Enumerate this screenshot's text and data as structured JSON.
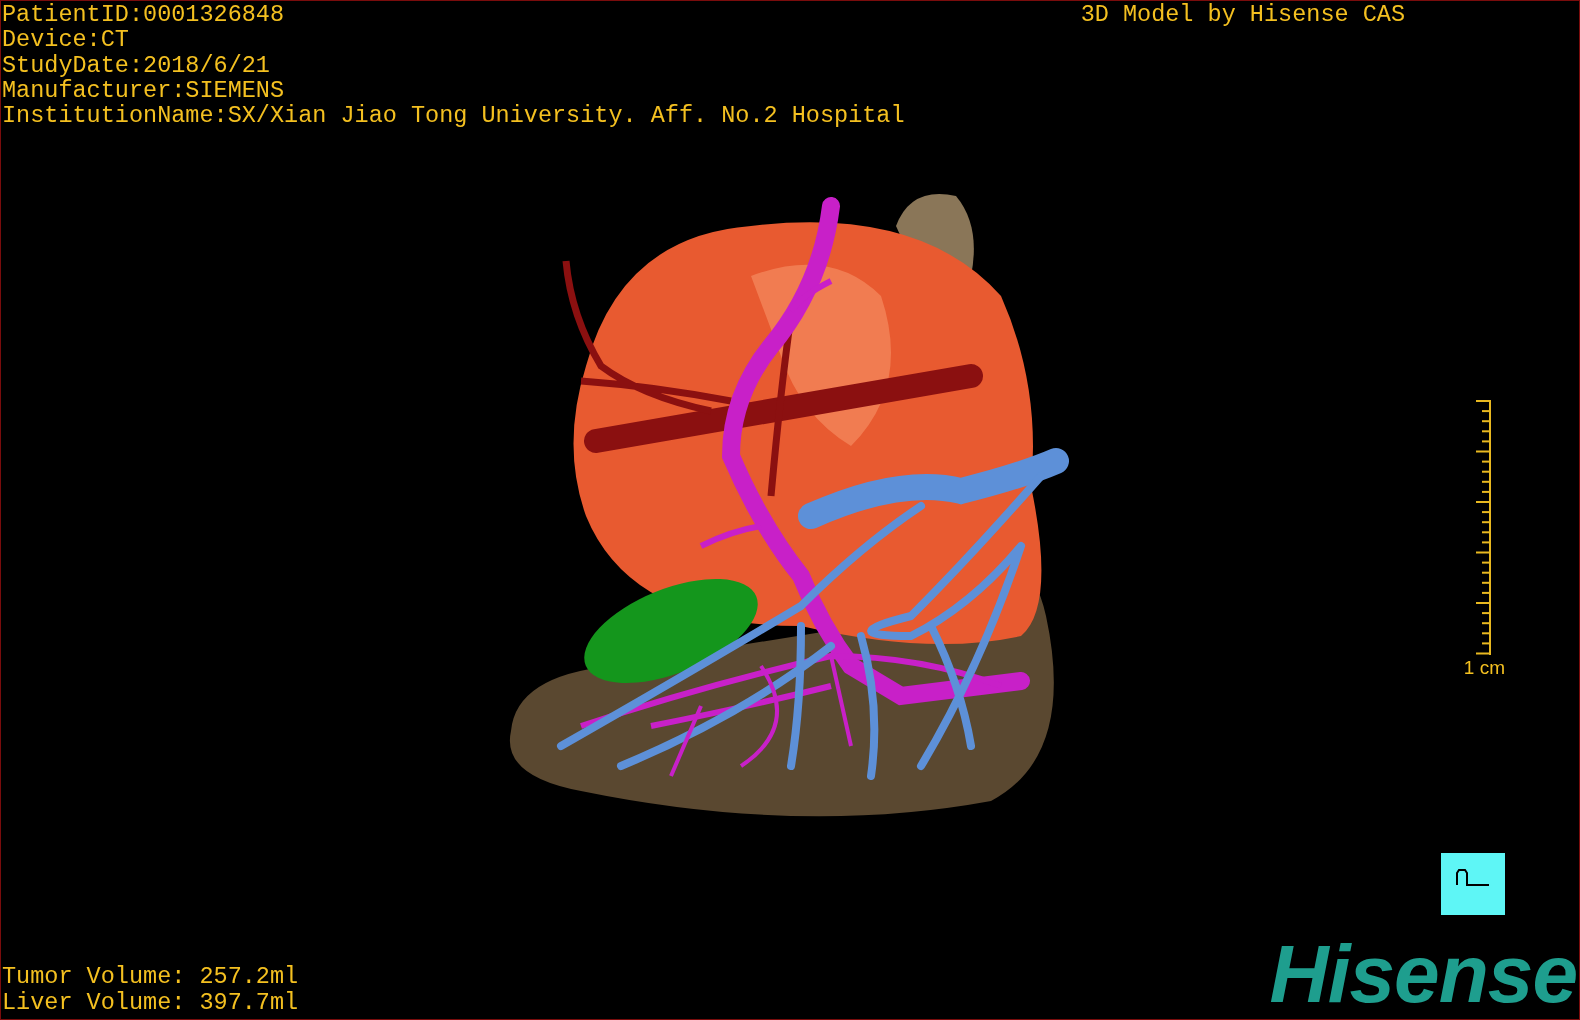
{
  "header_left": {
    "lines": [
      "PatientID:0001326848",
      "Device:CT",
      "StudyDate:2018/6/21",
      "Manufacturer:SIEMENS",
      "InstitutionName:SX/Xian Jiao Tong University. Aff. No.2 Hospital"
    ]
  },
  "header_right": {
    "title": "3D Model by Hisense CAS"
  },
  "scale_bar": {
    "label": "1 cm"
  },
  "volumes": [
    "Tumor Volume: 257.2ml",
    "Liver Volume: 397.7ml"
  ],
  "logo": {
    "text": "Hisense"
  }
}
